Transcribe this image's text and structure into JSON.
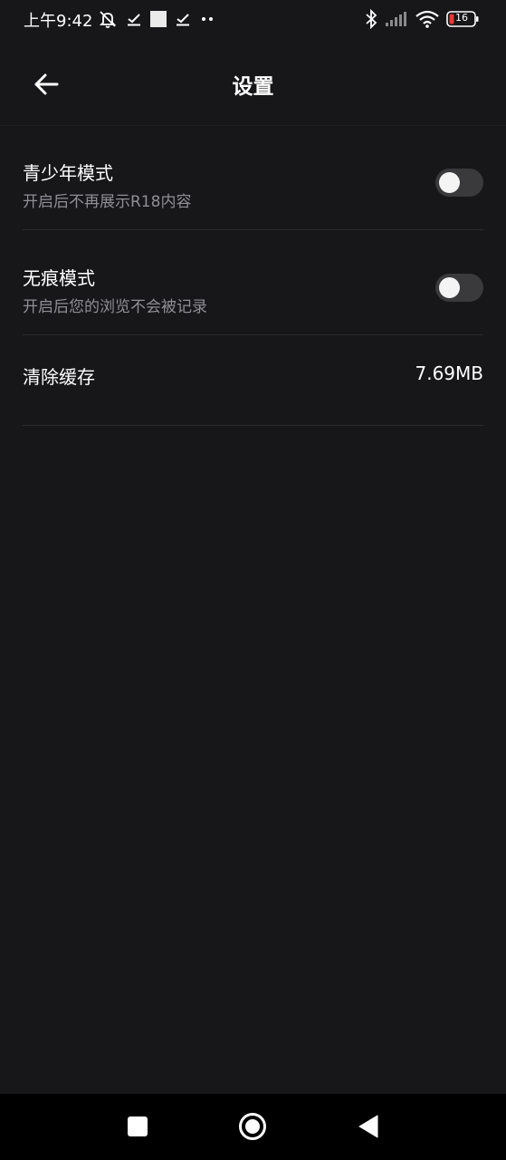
{
  "status_bar": {
    "time": "上午9:42",
    "battery_level": "16",
    "left_icons": [
      "mute-bell-icon",
      "check-icon",
      "square-icon",
      "check-icon",
      "more-dots-icon"
    ],
    "right_icons": [
      "bluetooth-icon",
      "signal-icon",
      "wifi-icon",
      "battery-icon"
    ],
    "battery_color": "#e53935"
  },
  "header": {
    "title": "设置",
    "back_icon": "arrow-left-icon"
  },
  "settings": [
    {
      "title": "青少年模式",
      "subtitle": "开启后不再展示R18内容",
      "toggle_on": false
    },
    {
      "title": "无痕模式",
      "subtitle": "开启后您的浏览不会被记录",
      "toggle_on": false
    }
  ],
  "cache": {
    "title": "清除缓存",
    "value": "7.69MB"
  },
  "nav_bar": {
    "buttons": [
      "recent-apps-icon",
      "home-icon",
      "back-triangle-icon"
    ]
  },
  "colors": {
    "background": "#17171a",
    "text_primary": "#ffffff",
    "text_secondary": "#8f8f94",
    "toggle_track": "#3a3a3d",
    "divider": "#2c2c2f"
  }
}
